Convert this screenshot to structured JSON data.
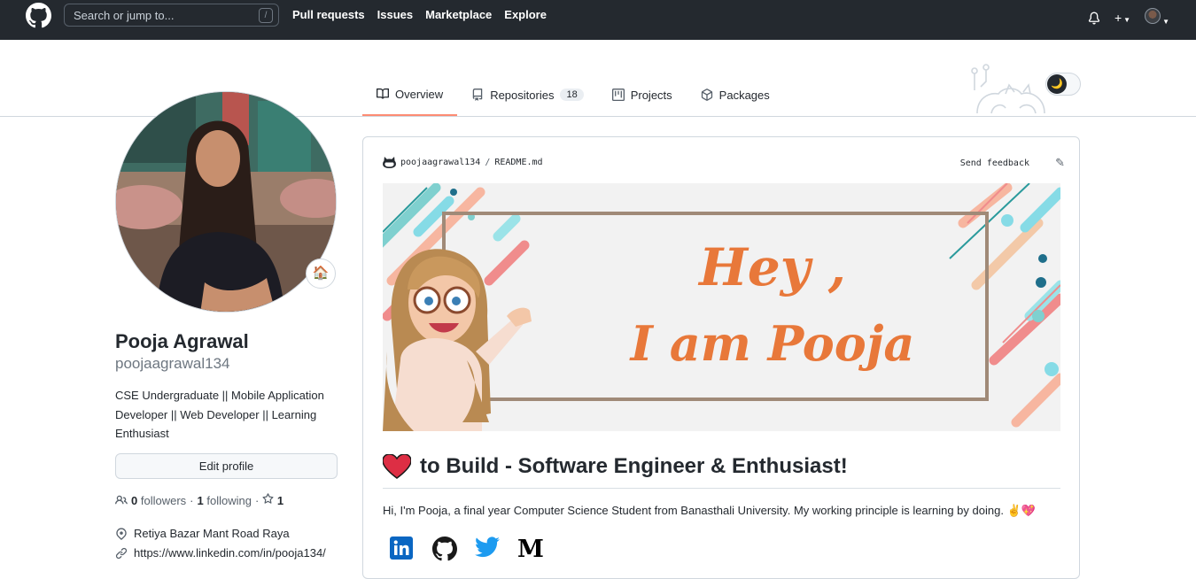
{
  "header": {
    "search_placeholder": "Search or jump to...",
    "search_shortcut": "/",
    "nav": [
      "Pull requests",
      "Issues",
      "Marketplace",
      "Explore"
    ]
  },
  "tabs": [
    {
      "label": "Overview",
      "active": true
    },
    {
      "label": "Repositories",
      "count": "18"
    },
    {
      "label": "Projects"
    },
    {
      "label": "Packages"
    }
  ],
  "profile": {
    "name": "Pooja Agrawal",
    "login": "poojaagrawal134",
    "bio": "CSE Undergraduate || Mobile Application Developer || Web Developer || Learning Enthusiast",
    "edit_label": "Edit profile",
    "followers_count": "0",
    "followers_label": "followers",
    "following_count": "1",
    "following_label": "following",
    "stars_count": "1",
    "location": "Retiya Bazar Mant Road Raya",
    "website": "https://www.linkedin.com/in/pooja134/"
  },
  "readme": {
    "owner": "poojaagrawal134",
    "file": "README.md",
    "feedback_label": "Send feedback",
    "banner_line1": "Hey ,",
    "banner_line2": "I am Pooja",
    "heading": "to Build - Software Engineer & Enthusiast!",
    "intro": "Hi, I'm Pooja, a final year Computer Science Student from Banasthali University. My working principle is learning by doing. ✌️💖"
  },
  "colors": {
    "header_bg": "#24292f",
    "tab_underline": "#fd8c73",
    "banner_text": "#e8783a",
    "linkedin": "#0a66c2",
    "twitter": "#1d9bf0"
  },
  "icons": [
    "github-logo-icon",
    "bell-icon",
    "plus-icon",
    "book-icon",
    "repo-icon",
    "project-icon",
    "package-icon",
    "people-icon",
    "star-icon",
    "location-icon",
    "link-icon",
    "pencil-icon",
    "heart-icon",
    "linkedin-icon",
    "github-icon",
    "twitter-icon",
    "medium-icon"
  ]
}
